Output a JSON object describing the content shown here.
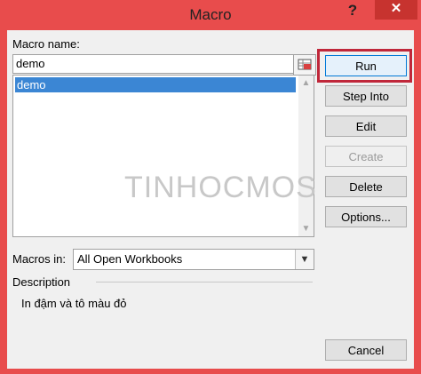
{
  "window": {
    "title": "Macro",
    "help_label": "?",
    "close_label": "✕"
  },
  "form": {
    "macro_name_label": "Macro name:",
    "macro_name_value": "demo",
    "macro_list": [
      "demo"
    ],
    "macros_in_label": "Macros in:",
    "macros_in_value": "All Open Workbooks",
    "description_label": "Description",
    "description_text": "In đậm và tô màu đỏ"
  },
  "watermark": "TINHOCMOS",
  "buttons": {
    "run": "Run",
    "step_into": "Step Into",
    "edit": "Edit",
    "create": "Create",
    "delete": "Delete",
    "options": "Options...",
    "cancel": "Cancel"
  },
  "colors": {
    "frame": "#e84c4c",
    "selection": "#3b86d4",
    "highlight": "#c0273a"
  }
}
